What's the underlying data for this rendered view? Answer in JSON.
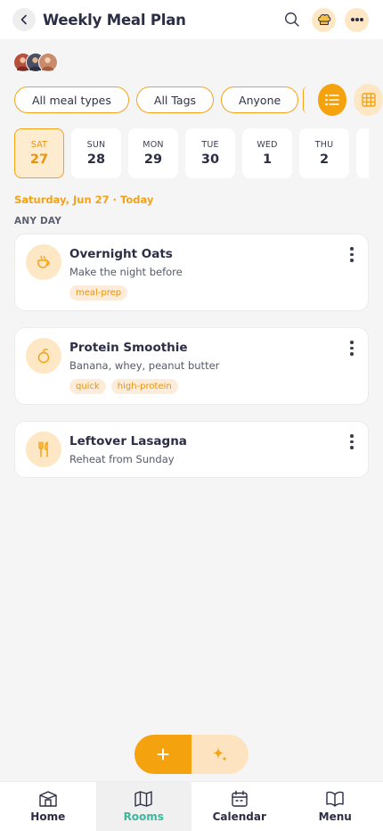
{
  "header": {
    "title": "Weekly Meal Plan",
    "back_icon": "chevron-left-icon",
    "search_icon": "search-icon",
    "chef_icon": "chef-hat-icon",
    "more_icon": "more-horizontal-icon"
  },
  "participants": [
    {
      "name": "avatar-1",
      "color": "#b5523f"
    },
    {
      "name": "avatar-2",
      "color": "#4a4f63"
    },
    {
      "name": "avatar-3",
      "color": "#c98b6b"
    }
  ],
  "filters": {
    "meal_types": "All meal types",
    "tags": "All Tags",
    "people": "Anyone"
  },
  "days": [
    {
      "name": "SAT",
      "num": "27",
      "selected": true
    },
    {
      "name": "SUN",
      "num": "28"
    },
    {
      "name": "MON",
      "num": "29"
    },
    {
      "name": "TUE",
      "num": "30"
    },
    {
      "name": "WED",
      "num": "1"
    },
    {
      "name": "THU",
      "num": "2"
    }
  ],
  "selected_date_label": "Saturday, Jun 27 · Today",
  "section_title": "ANY DAY",
  "meals": [
    {
      "title": "Overnight Oats",
      "subtitle": "Make the night before",
      "tags": [
        "meal-prep"
      ],
      "icon": "coffee-cup-icon"
    },
    {
      "title": "Protein Smoothie",
      "subtitle": "Banana, whey, peanut butter",
      "tags": [
        "quick",
        "high-protein"
      ],
      "icon": "fruit-icon"
    },
    {
      "title": "Leftover Lasagna",
      "subtitle": "Reheat from Sunday",
      "tags": [],
      "icon": "fork-knife-icon"
    }
  ],
  "tabbar": {
    "home": "Home",
    "rooms": "Rooms",
    "calendar": "Calendar",
    "menu": "Menu",
    "active": "rooms"
  },
  "colors": {
    "accent": "#f4a318",
    "accent_light": "#fde7c5",
    "active_tab": "#3bb89b"
  }
}
